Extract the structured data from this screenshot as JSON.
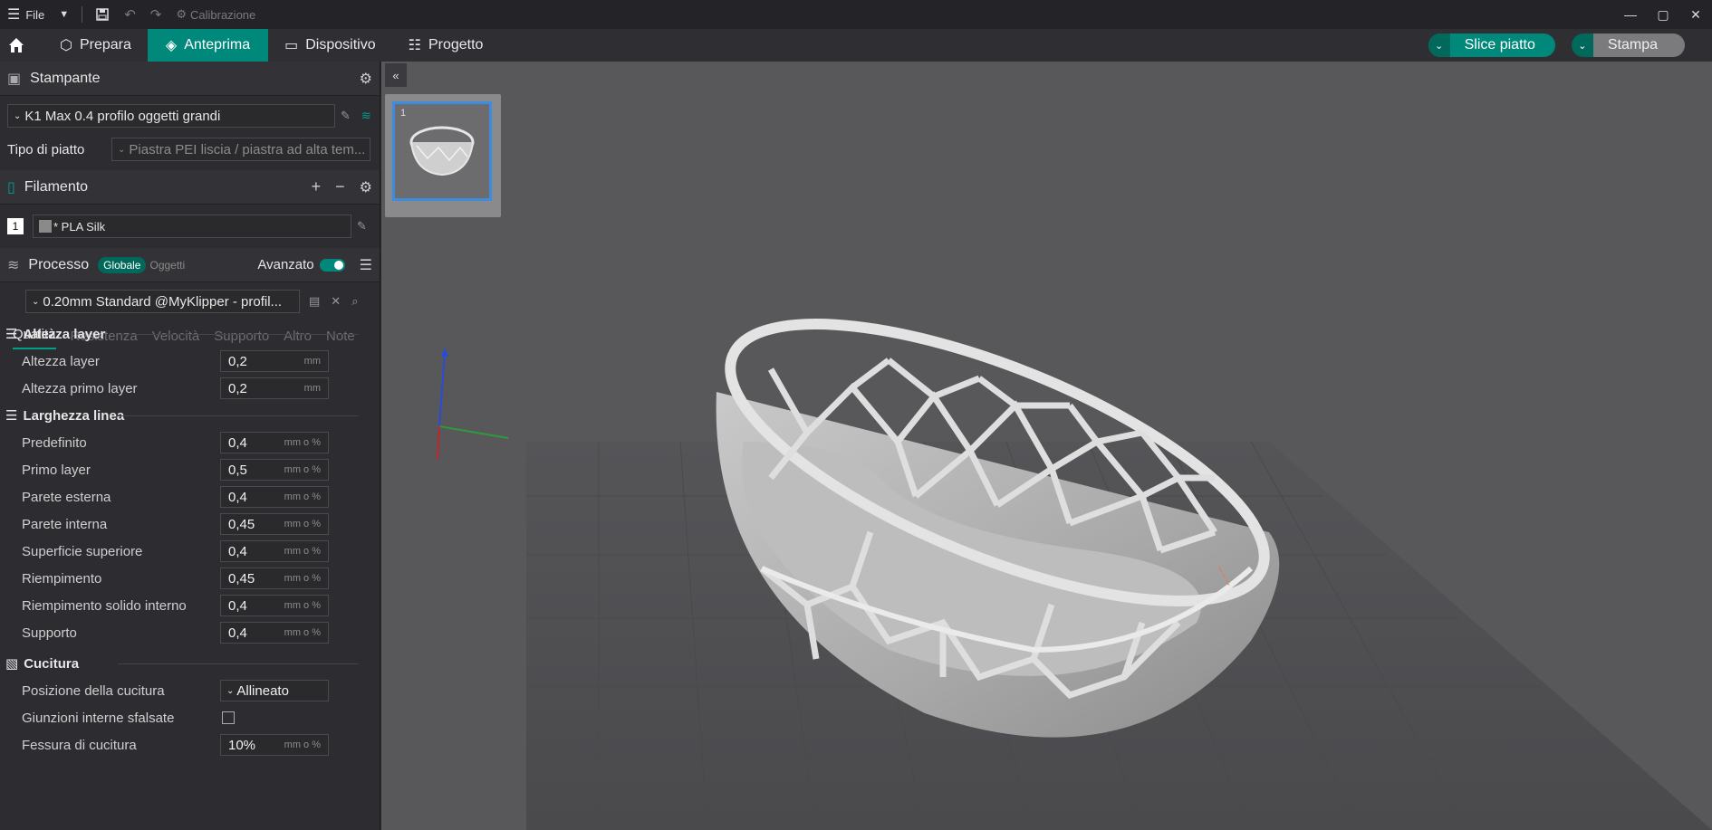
{
  "titlebar": {
    "file_label": "File",
    "calibration_label": "Calibrazione"
  },
  "nav": {
    "tabs": [
      {
        "label": "Prepara"
      },
      {
        "label": "Anteprima"
      },
      {
        "label": "Dispositivo"
      },
      {
        "label": "Progetto"
      }
    ],
    "slice_label": "Slice piatto",
    "print_label": "Stampa"
  },
  "printer": {
    "header": "Stampante",
    "profile": "K1 Max 0.4 profilo oggetti grandi",
    "plate_label": "Tipo di piatto",
    "plate_value": "Piastra PEI liscia / piastra ad alta tem..."
  },
  "filament": {
    "header": "Filamento",
    "slot": "1",
    "name": "* PLA Silk"
  },
  "process": {
    "header": "Processo",
    "global": "Globale",
    "objects": "Oggetti",
    "advanced": "Avanzato",
    "profile": "0.20mm Standard @MyKlipper - profil..."
  },
  "tabs": [
    "Qualità",
    "Resistenza",
    "Velocità",
    "Supporto",
    "Altro",
    "Note"
  ],
  "groups": {
    "layer": {
      "title": "Altezza layer",
      "items": [
        {
          "label": "Altezza layer",
          "value": "0,2",
          "unit": "mm"
        },
        {
          "label": "Altezza primo layer",
          "value": "0,2",
          "unit": "mm"
        }
      ]
    },
    "width": {
      "title": "Larghezza linea",
      "items": [
        {
          "label": "Predefinito",
          "value": "0,4",
          "unit": "mm o %"
        },
        {
          "label": "Primo layer",
          "value": "0,5",
          "unit": "mm o %"
        },
        {
          "label": "Parete esterna",
          "value": "0,4",
          "unit": "mm o %"
        },
        {
          "label": "Parete interna",
          "value": "0,45",
          "unit": "mm o %"
        },
        {
          "label": "Superficie superiore",
          "value": "0,4",
          "unit": "mm o %"
        },
        {
          "label": "Riempimento",
          "value": "0,45",
          "unit": "mm o %"
        },
        {
          "label": "Riempimento solido interno",
          "value": "0,4",
          "unit": "mm o %"
        },
        {
          "label": "Supporto",
          "value": "0,4",
          "unit": "mm o %"
        }
      ]
    },
    "seam": {
      "title": "Cucitura",
      "position_label": "Posizione della cucitura",
      "position_value": "Allineato",
      "staggered_label": "Giunzioni interne sfalsate",
      "gap_label": "Fessura di cucitura",
      "gap_value": "10%",
      "gap_unit": "mm o %"
    }
  },
  "viewport": {
    "plate_number": "1"
  },
  "colors": {
    "accent": "#00897b",
    "selection": "#3c8de0"
  }
}
